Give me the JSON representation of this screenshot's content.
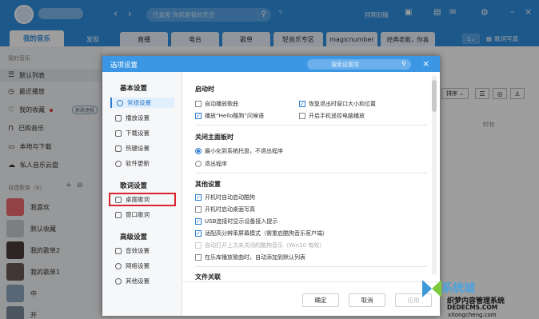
{
  "topbar": {
    "search_placeholder": "任嘉俊 你就是我的天空",
    "nav_items": [
      "回到旧版"
    ]
  },
  "tabs": [
    "我的音乐",
    "发现",
    "直播",
    "电台",
    "歌单",
    "轻音乐专区",
    "magicnumber",
    "经典老歌，你喜",
    "歌词写真"
  ],
  "sidebar": {
    "heading": "我的音乐",
    "items": [
      "默认列表",
      "最近播放",
      "我的收藏",
      "已购音乐",
      "本地与下载",
      "私人音乐云盘"
    ],
    "fav_badge": "新歌速报",
    "playlist_heading": "自建歌单（6）",
    "playlists": [
      "我喜欢",
      "默认收藏",
      "我的歌单2",
      "我的歌单1",
      "中",
      "开"
    ]
  },
  "main": {
    "sort_label": "排序",
    "col_duration": "时长"
  },
  "dialog": {
    "title": "选项设置",
    "search_placeholder": "搜索设置项",
    "close": "×",
    "categories": [
      {
        "label": "基本设置",
        "items": [
          "常规设置",
          "播放设置",
          "下载设置",
          "热键设置",
          "软件更新"
        ]
      },
      {
        "label": "歌词设置",
        "items": [
          "桌面歌词",
          "窗口歌词"
        ]
      },
      {
        "label": "高级设置",
        "items": [
          "音效设置",
          "网络设置",
          "其他设置"
        ]
      }
    ],
    "sections": {
      "startup": {
        "title": "启动时",
        "options": [
          "自动播放歌曲",
          "恢复退出时窗口大小和位置",
          "播放“Hello酷狗”问候语",
          "开启手机遥控电脑播放"
        ]
      },
      "close_panel": {
        "title": "关闭主面板时",
        "options": [
          "最小化到系统托盘，不退出程序",
          "退出程序"
        ]
      },
      "other": {
        "title": "其他设置",
        "options": [
          "开机时自动启动酷狗",
          "开机时启动桌面写真",
          "USB连接时显示设备接入提示",
          "适配高分辨率屏幕模式（需重启酷狗音乐客户端）",
          "自动打开上次未关闭的酷狗音乐（Win10 有效）",
          "在乐库播放歌曲时，自动添加到默认列表"
        ]
      },
      "file_assoc": {
        "title": "文件关联"
      }
    },
    "buttons": {
      "ok": "确定",
      "cancel": "取消",
      "apply": "应用"
    }
  },
  "watermark": {
    "line1": "系统城",
    "line2": "织梦内容管理系统",
    "line3": "DEDECMS.COM",
    "line4": "xitongcheng.com"
  },
  "colors": {
    "accent": "#2f8fe0",
    "highlight": "#d9232d"
  }
}
